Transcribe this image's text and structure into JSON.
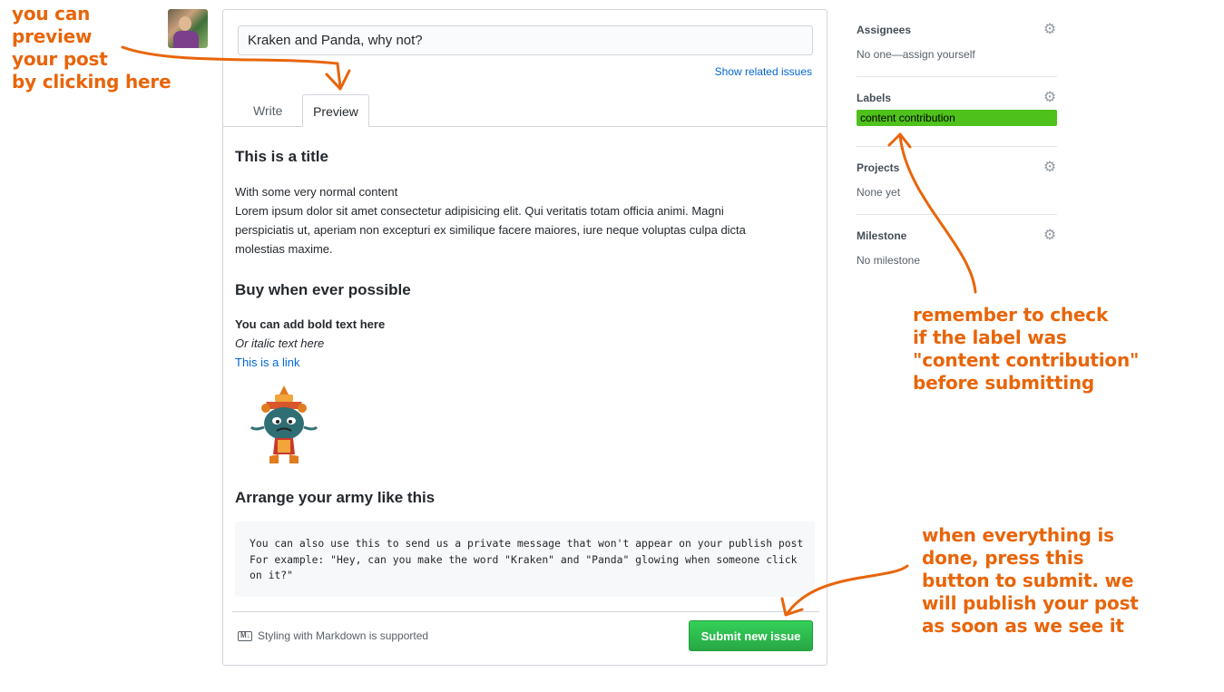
{
  "annotations": {
    "preview_lines": [
      "you can",
      "preview",
      "your post",
      "by clicking here"
    ],
    "label_lines": [
      "remember to check",
      "if the label was",
      "\"content contribution\"",
      "before submitting"
    ],
    "submit_lines": [
      "when everything is",
      "done, press this",
      "button to submit. we",
      "will publish your post",
      "as soon as we see it"
    ],
    "color": "#e8650a"
  },
  "form": {
    "title_value": "Kraken and Panda, why not?",
    "show_related": "Show related issues",
    "tabs": [
      "Write",
      "Preview"
    ],
    "active_tab": "Preview"
  },
  "preview": {
    "heading1": "This is a title",
    "paragraph_lines": [
      "With some very normal content",
      "Lorem ipsum dolor sit amet consectetur adipisicing elit. Qui veritatis totam officia animi. Magni",
      "perspiciatis ut, aperiam non excepturi ex similique facere maiores, iure neque voluptas culpa dicta",
      "molestias maxime."
    ],
    "heading2": "Buy when ever possible",
    "bold_text": "You can add bold text here",
    "italic_text": "Or italic text here",
    "link_text": "This is a link",
    "heading3": "Arrange your army like this",
    "code_lines": [
      "You can also use this to send us a private message that won't appear on your publish post",
      "For example: \"Hey, can you make the word \"Kraken\" and \"Panda\" glowing when someone click",
      "on it?\""
    ]
  },
  "footer": {
    "markdown_note": "Styling with Markdown is supported",
    "markdown_icon": "markdown-icon",
    "submit_label": "Submit new issue",
    "submit_color": "#28a745"
  },
  "sidebar": {
    "assignees": {
      "title": "Assignees",
      "value": "No one—assign yourself"
    },
    "labels": {
      "title": "Labels",
      "chip": "content contribution",
      "chip_color": "#4fc11b"
    },
    "projects": {
      "title": "Projects",
      "value": "None yet"
    },
    "milestone": {
      "title": "Milestone",
      "value": "No milestone"
    }
  }
}
